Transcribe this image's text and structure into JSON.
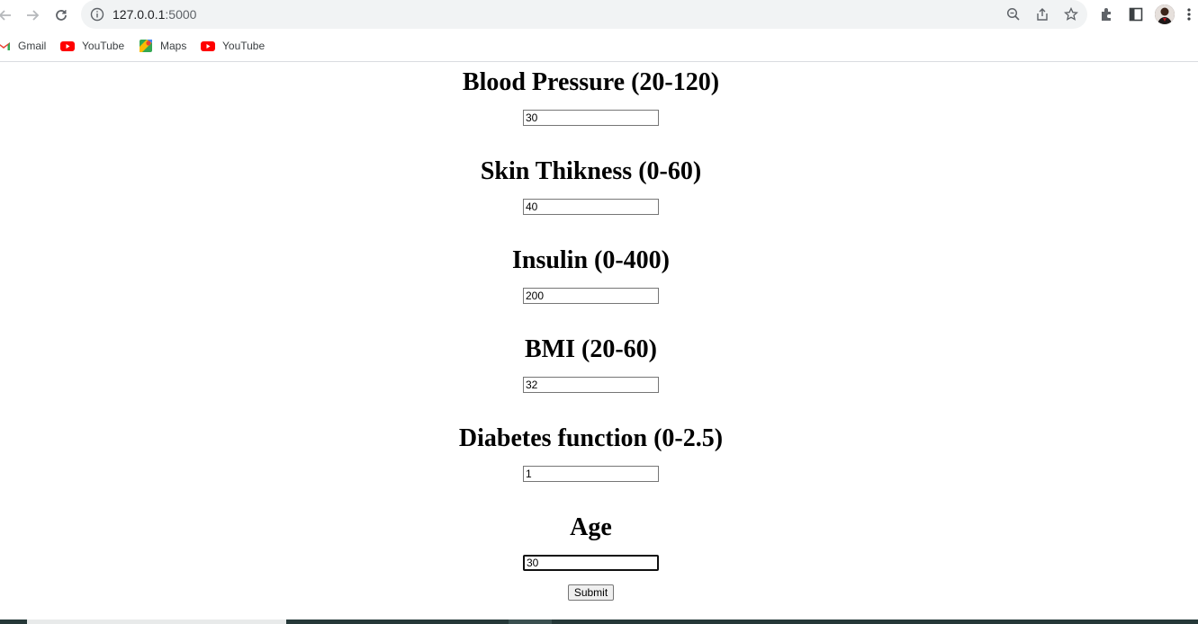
{
  "browser": {
    "url_host": "127.0.0.1",
    "url_port": ":5000",
    "bookmarks": [
      {
        "label": "Gmail",
        "icon": "gmail-icon"
      },
      {
        "label": "YouTube",
        "icon": "youtube-icon"
      },
      {
        "label": "Maps",
        "icon": "maps-icon"
      },
      {
        "label": "YouTube",
        "icon": "youtube-icon"
      }
    ]
  },
  "form": {
    "fields": [
      {
        "label": "Blood Pressure (20-120)",
        "value": "30"
      },
      {
        "label": "Skin Thikness (0-60)",
        "value": "40"
      },
      {
        "label": "Insulin (0-400)",
        "value": "200"
      },
      {
        "label": "BMI (20-60)",
        "value": "32"
      },
      {
        "label": "Diabetes function (0-2.5)",
        "value": "1"
      },
      {
        "label": "Age",
        "value": "30"
      }
    ],
    "submit_label": "Submit"
  },
  "colors": {
    "youtube_red": "#ff0000",
    "omnibox_bg": "#f1f3f4",
    "taskbar": "#253838"
  }
}
